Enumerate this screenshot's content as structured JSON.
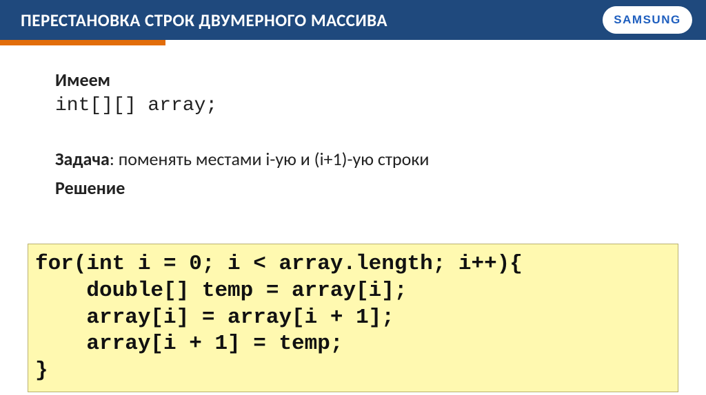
{
  "header": {
    "title": "ПЕРЕСТАНОВКА СТРОК ДВУМЕРНОГО МАССИВА",
    "logo_text": "SAMSUNG"
  },
  "body": {
    "have_label": "Имеем",
    "declaration": "int[][] array;",
    "task_prefix": "Задача",
    "task_text": ": поменять местами i-ую и (i+1)-ую строки",
    "solution_label": "Решение"
  },
  "code": {
    "l1": "for(int i = 0; i < array.length; i++){",
    "l2": "    double[] temp = array[i];",
    "l3": "    array[i] = array[i + 1];",
    "l4": "    array[i + 1] = temp;",
    "l5": "}"
  }
}
